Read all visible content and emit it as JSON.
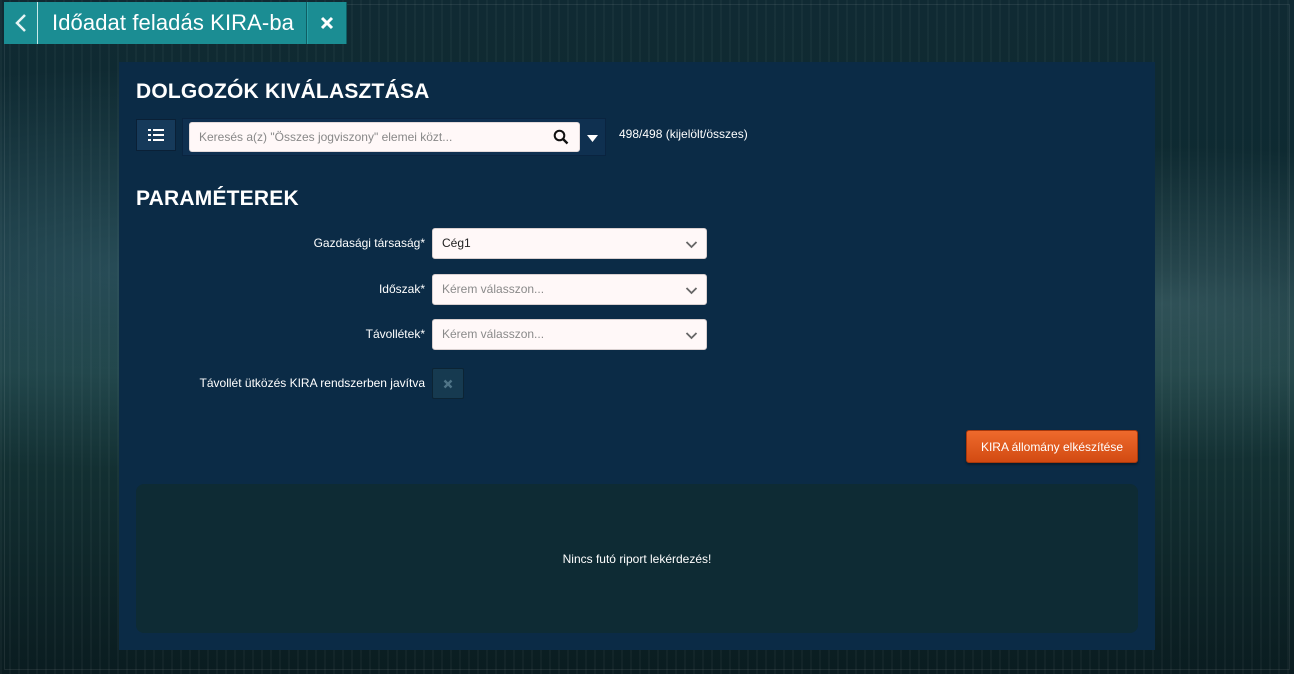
{
  "header": {
    "back_icon": "chevron-left-icon",
    "title": "Időadat feladás KIRA-ba",
    "close_icon": "close-icon"
  },
  "employees": {
    "title": "DOLGOZÓK KIVÁLASZTÁSA",
    "list_icon": "list-icon",
    "search_placeholder": "Keresés a(z) \"Összes jogviszony\" elemei közt...",
    "search_icon": "search-icon",
    "dropdown_icon": "caret-down-icon",
    "count_text": "498/498 (kijelölt/összes)"
  },
  "parameters": {
    "title": "PARAMÉTEREK",
    "company": {
      "label": "Gazdasági társaság*",
      "value": "Cég1"
    },
    "period": {
      "label": "Időszak*",
      "placeholder": "Kérem válasszon..."
    },
    "absences": {
      "label": "Távollétek*",
      "placeholder": "Kérem válasszon..."
    },
    "collision_fix": {
      "label": "Távollét ütközés KIRA rendszerben javítva",
      "checked": false
    }
  },
  "actions": {
    "generate_label": "KIRA állomány elkészítése"
  },
  "report": {
    "status_text": "Nincs futó riport lekérdezés!"
  },
  "colors": {
    "tab_bg": "#1b8d93",
    "panel_bg": "#0b2b46",
    "action_orange": "#e05a1e",
    "report_bg": "#0e2b34"
  }
}
